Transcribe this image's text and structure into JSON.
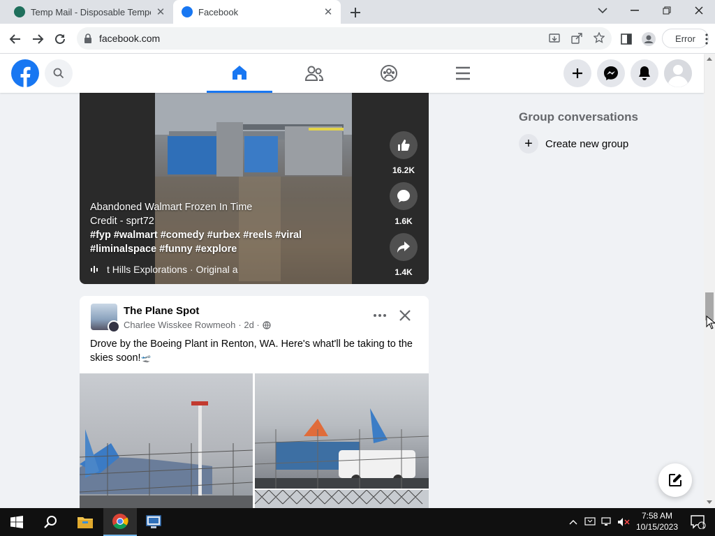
{
  "browser": {
    "tabs": [
      {
        "title": "Temp Mail - Disposable Temporary",
        "close": "✕",
        "active": false
      },
      {
        "title": "Facebook",
        "close": "✕",
        "active": true
      }
    ],
    "url": "facebook.com",
    "error_label": "Error",
    "icons": [
      "back-icon",
      "forward-icon",
      "reload-icon",
      "lock-icon",
      "install-icon",
      "share-icon",
      "star-icon",
      "sidepanel-icon",
      "profile-icon"
    ]
  },
  "facebook": {
    "nav": [
      {
        "name": "home",
        "active": true
      },
      {
        "name": "friends",
        "active": false
      },
      {
        "name": "groups",
        "active": false
      },
      {
        "name": "menu",
        "active": false
      }
    ],
    "brand_color": "#1877f2"
  },
  "reel": {
    "caption_line1": "Abandoned Walmart Frozen In Time",
    "caption_line2": "Credit - sprt72",
    "hashtags_line1": "#fyp #walmart #comedy #urbex #reels #viral",
    "hashtags_line2": "#liminalspace #funny #explore",
    "audio": "t Hills Explorations · Original a",
    "likes": "16.2K",
    "comments": "1.6K",
    "shares": "1.4K"
  },
  "post": {
    "author": "The Plane Spot",
    "subtitle": "Charlee Wisskee Rowmeoh",
    "time": "· 2d ·",
    "text": "Drove by the Boeing Plant in Renton, WA. Here's what'll be taking to the skies soon!",
    "emoji": "🛫"
  },
  "sidebar": {
    "group_title": "Group conversations",
    "create_group": "Create new group",
    "plus": "+"
  },
  "taskbar": {
    "time": "7:58 AM",
    "date": "10/15/2023",
    "notification_count": "1"
  }
}
